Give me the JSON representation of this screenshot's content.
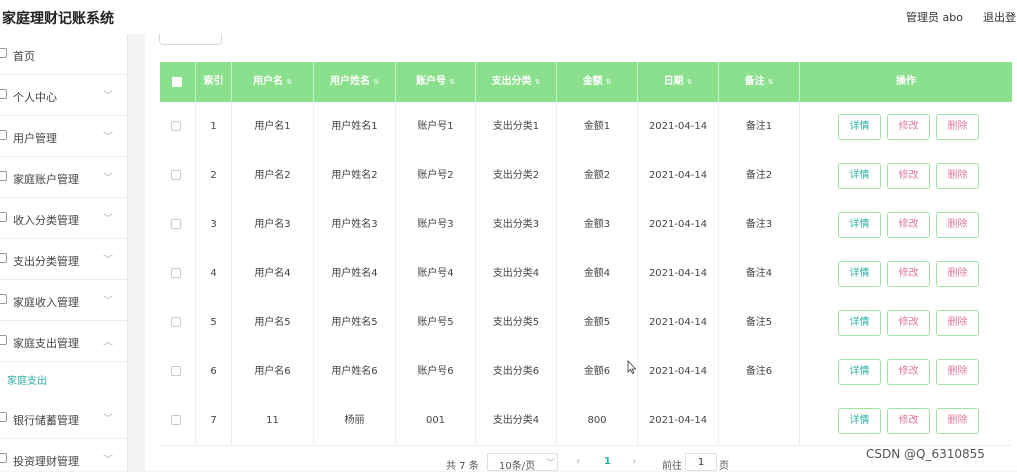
{
  "header": {
    "title": "家庭理财记账系统",
    "user": "管理员 abo",
    "logout": "退出登"
  },
  "sidebar": {
    "items": [
      {
        "label": "首页",
        "icon": "home-icon"
      },
      {
        "label": "个人中心",
        "icon": "person-icon"
      },
      {
        "label": "用户管理",
        "icon": "users-icon"
      },
      {
        "label": "家庭账户管理",
        "icon": "account-icon"
      },
      {
        "label": "收入分类管理",
        "icon": "category-icon"
      },
      {
        "label": "支出分类管理",
        "icon": "category-icon"
      },
      {
        "label": "家庭收入管理",
        "icon": "income-icon"
      },
      {
        "label": "家庭支出管理",
        "icon": "expense-icon"
      },
      {
        "label": "银行储蓄管理",
        "icon": "bank-icon"
      },
      {
        "label": "投资理财管理",
        "icon": "invest-icon"
      }
    ],
    "sub_item": "家庭支出"
  },
  "table": {
    "headers": [
      "索引",
      "用户名",
      "用户姓名",
      "账户号",
      "支出分类",
      "金额",
      "日期",
      "备注",
      "操作"
    ],
    "actions": {
      "detail": "详情",
      "edit": "修改",
      "delete": "删除"
    },
    "rows": [
      {
        "index": "1",
        "username": "用户名1",
        "name": "用户姓名1",
        "account": "账户号1",
        "category": "支出分类1",
        "amount": "金额1",
        "date": "2021-04-14",
        "note": "备注1"
      },
      {
        "index": "2",
        "username": "用户名2",
        "name": "用户姓名2",
        "account": "账户号2",
        "category": "支出分类2",
        "amount": "金额2",
        "date": "2021-04-14",
        "note": "备注2"
      },
      {
        "index": "3",
        "username": "用户名3",
        "name": "用户姓名3",
        "account": "账户号3",
        "category": "支出分类3",
        "amount": "金额3",
        "date": "2021-04-14",
        "note": "备注3"
      },
      {
        "index": "4",
        "username": "用户名4",
        "name": "用户姓名4",
        "account": "账户号4",
        "category": "支出分类4",
        "amount": "金额4",
        "date": "2021-04-14",
        "note": "备注4"
      },
      {
        "index": "5",
        "username": "用户名5",
        "name": "用户姓名5",
        "account": "账户号5",
        "category": "支出分类5",
        "amount": "金额5",
        "date": "2021-04-14",
        "note": "备注5"
      },
      {
        "index": "6",
        "username": "用户名6",
        "name": "用户姓名6",
        "account": "账户号6",
        "category": "支出分类6",
        "amount": "金额6",
        "date": "2021-04-14",
        "note": "备注6"
      },
      {
        "index": "7",
        "username": "11",
        "name": "杨丽",
        "account": "001",
        "category": "支出分类4",
        "amount": "800",
        "date": "2021-04-14",
        "note": ""
      }
    ]
  },
  "pagination": {
    "total": "共 7 条",
    "page_size": "10条/页",
    "prev": "‹",
    "current": "1",
    "next": "›",
    "goto": "前往",
    "goto_value": "1",
    "unit": "页"
  },
  "watermark": "CSDN @Q_6310855",
  "colors": {
    "header_green": "#8be08e",
    "accent": "#2bb0a5",
    "danger": "#e07a9c"
  }
}
